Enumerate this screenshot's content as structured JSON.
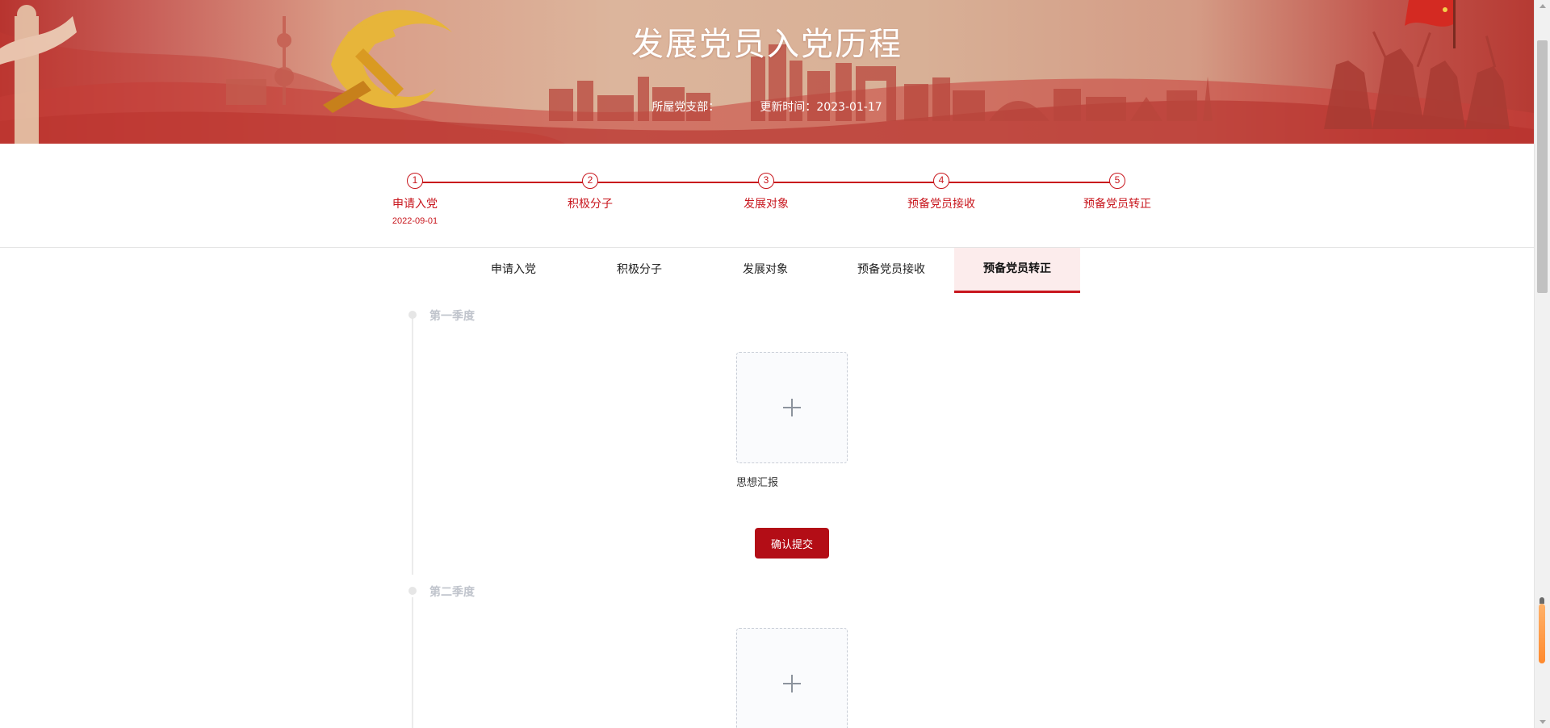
{
  "banner": {
    "title": "发展党员入党历程",
    "branch_label": "所屋党支部：",
    "branch_value": "",
    "update_label": "更新时间：",
    "update_value": "2023-01-17"
  },
  "steps": [
    {
      "num": "1",
      "label": "申请入党",
      "date": "2022-09-01"
    },
    {
      "num": "2",
      "label": "积极分子",
      "date": ""
    },
    {
      "num": "3",
      "label": "发展对象",
      "date": ""
    },
    {
      "num": "4",
      "label": "预备党员接收",
      "date": ""
    },
    {
      "num": "5",
      "label": "预备党员转正",
      "date": ""
    }
  ],
  "tabs": [
    {
      "label": "申请入党",
      "active": false
    },
    {
      "label": "积极分子",
      "active": false
    },
    {
      "label": "发展对象",
      "active": false
    },
    {
      "label": "预备党员接收",
      "active": false
    },
    {
      "label": "预备党员转正",
      "active": true
    }
  ],
  "sections": [
    {
      "title": "第一季度",
      "upload_label": "思想汇报",
      "submit_label": "确认提交"
    },
    {
      "title": "第二季度",
      "upload_label": "",
      "submit_label": ""
    }
  ],
  "colors": {
    "accent": "#c8161d",
    "button": "#b30d16",
    "active_tab_bg": "#fcecec"
  },
  "icons": [
    "plus-icon",
    "party-emblem-icon",
    "flag-icon"
  ]
}
